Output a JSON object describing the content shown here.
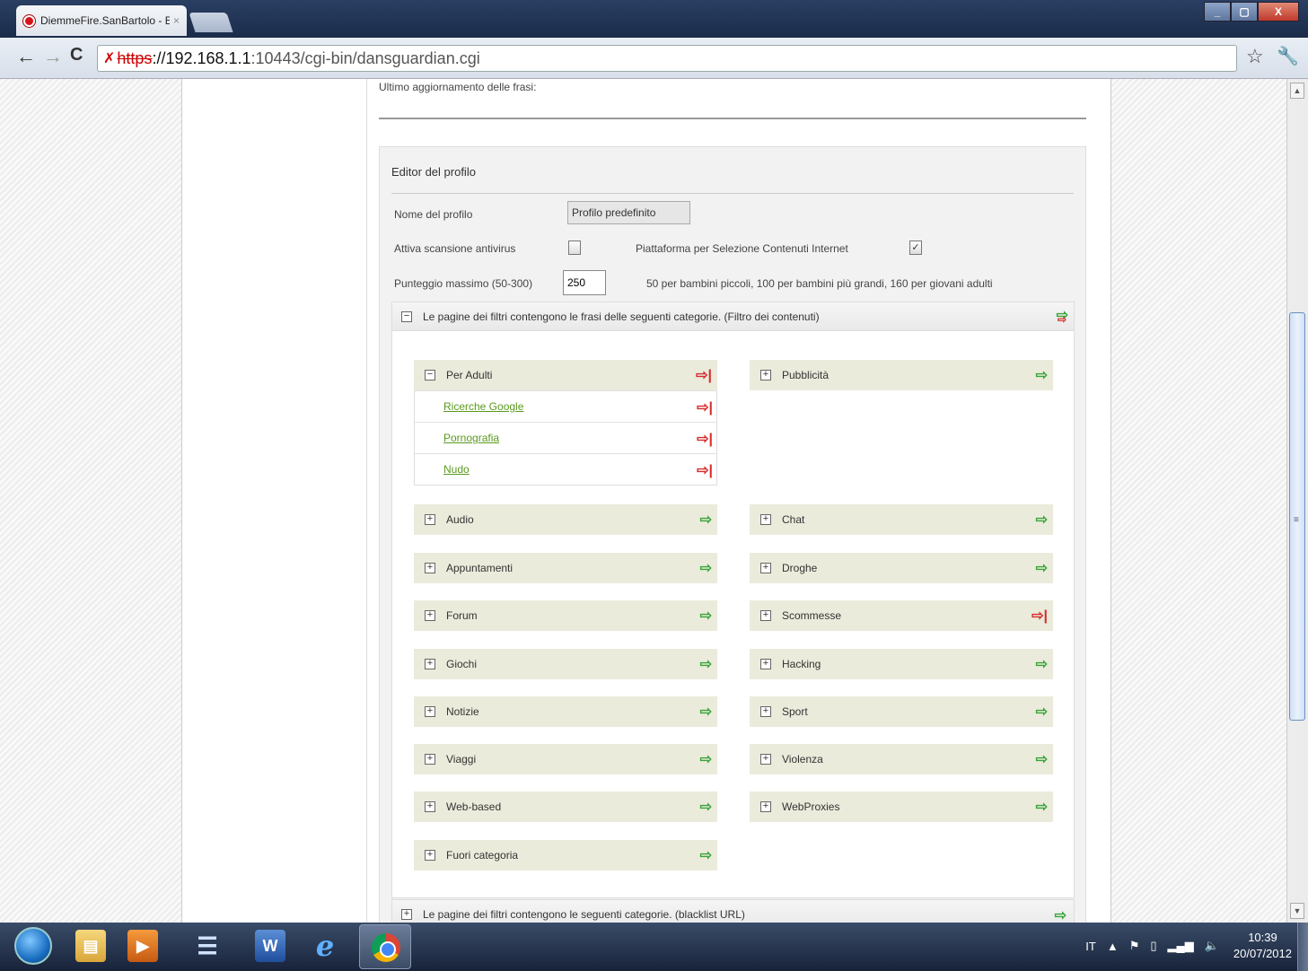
{
  "browser": {
    "tab_title": "DiemmeFire.SanBartolo - E",
    "tab_close": "×",
    "url_scheme": "https",
    "url_host": "://192.168.1.1",
    "url_rest": ":10443/cgi-bin/dansguardian.cgi"
  },
  "page": {
    "last_update_label": "Ultimo aggiornamento delle frasi:",
    "editor_title": "Editor del profilo",
    "profile_name_label": "Nome del profilo",
    "profile_name_value": "Profilo predefinito",
    "antivirus_label": "Attiva scansione antivirus",
    "antivirus_checked": false,
    "pics_label": "Piattaforma per Selezione Contenuti Internet",
    "pics_checked": true,
    "pics_check_glyph": "✓",
    "max_score_label": "Punteggio massimo (50-300)",
    "max_score_value": "250",
    "max_score_hint": "50 per bambini piccoli, 100 per bambini più grandi, 160 per giovani adulti",
    "phrase_panel_title": "Le pagine dei filtri contengono le frasi delle seguenti categorie. (Filtro dei contenuti)",
    "url_panel_title": "Le pagine dei filtri contengono le seguenti categorie. (blacklist URL)"
  },
  "categories": {
    "per_adulti": {
      "label": "Per Adulti",
      "state": "blocked"
    },
    "per_adulti_subs": [
      {
        "label": "Ricerche Google",
        "state": "blocked"
      },
      {
        "label": "Pornografia",
        "state": "blocked"
      },
      {
        "label": "Nudo",
        "state": "blocked"
      }
    ],
    "pubblicita": {
      "label": "Pubblicità",
      "state": "allowed"
    },
    "audio": {
      "label": "Audio",
      "state": "allowed"
    },
    "chat": {
      "label": "Chat",
      "state": "allowed"
    },
    "appuntamenti": {
      "label": "Appuntamenti",
      "state": "allowed"
    },
    "droghe": {
      "label": "Droghe",
      "state": "allowed"
    },
    "forum": {
      "label": "Forum",
      "state": "allowed"
    },
    "scommesse": {
      "label": "Scommesse",
      "state": "blocked"
    },
    "giochi": {
      "label": "Giochi",
      "state": "allowed"
    },
    "hacking": {
      "label": "Hacking",
      "state": "allowed"
    },
    "notizie": {
      "label": "Notizie",
      "state": "allowed"
    },
    "sport": {
      "label": "Sport",
      "state": "allowed"
    },
    "viaggi": {
      "label": "Viaggi",
      "state": "allowed"
    },
    "violenza": {
      "label": "Violenza",
      "state": "allowed"
    },
    "webbased": {
      "label": "Web-based",
      "state": "allowed"
    },
    "webproxies": {
      "label": "WebProxies",
      "state": "allowed"
    },
    "fuori": {
      "label": "Fuori categoria",
      "state": "allowed"
    }
  },
  "glyphs": {
    "allowed_arrow": "⇨",
    "blocked_arrow": "⇨|",
    "expand": "+",
    "collapse": "−"
  },
  "taskbar": {
    "lang": "IT",
    "time": "10:39",
    "date": "20/07/2012"
  },
  "colors": {
    "allowed": "#3aa53a",
    "blocked": "#d62b2b",
    "link": "#5a9a1e",
    "category_bg": "#ebebdc"
  }
}
